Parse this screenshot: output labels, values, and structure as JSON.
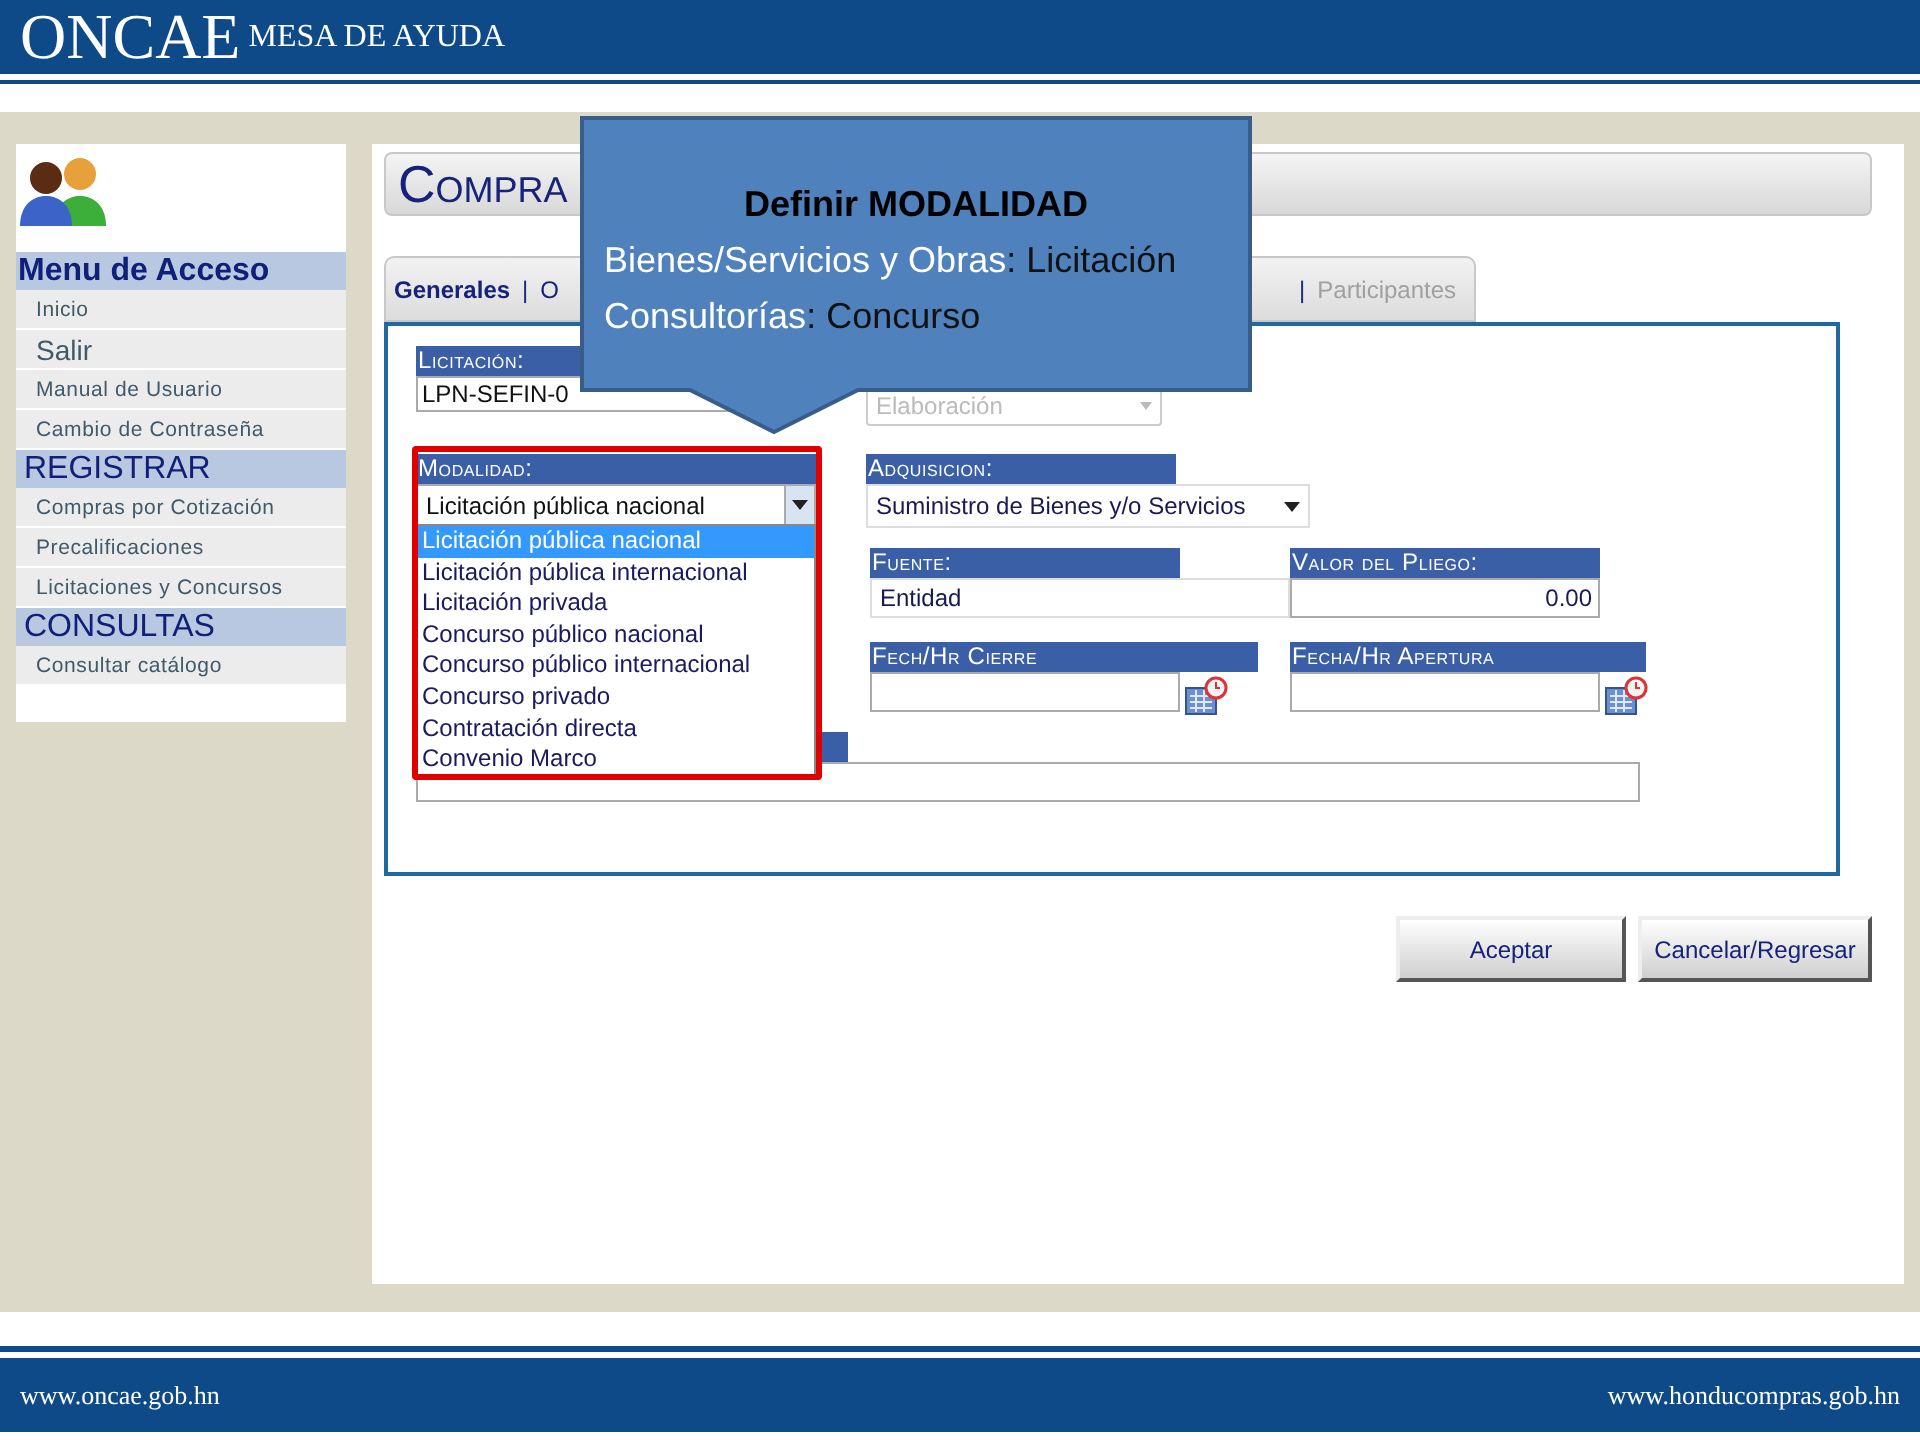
{
  "header": {
    "brand": "ONCAE",
    "subtitle": "MESA DE AYUDA"
  },
  "sidebar": {
    "sections": [
      {
        "title": "Menu de Acceso",
        "kind": "primary",
        "items": [
          {
            "label": "Inicio",
            "kind": "normal"
          },
          {
            "label": "Salir",
            "kind": "large"
          },
          {
            "label": "Manual de Usuario",
            "kind": "normal"
          },
          {
            "label": "Cambio de Contraseña",
            "kind": "normal"
          }
        ]
      },
      {
        "title": "REGISTRAR",
        "kind": "secondary",
        "items": [
          {
            "label": "Compras por Cotización",
            "kind": "normal"
          },
          {
            "label": "Precalificaciones",
            "kind": "normal"
          },
          {
            "label": "Licitaciones y Concursos",
            "kind": "normal"
          }
        ]
      },
      {
        "title": "CONSULTAS",
        "kind": "secondary",
        "items": [
          {
            "label": "Consultar catálogo",
            "kind": "normal"
          }
        ]
      }
    ]
  },
  "page_title": "Compra",
  "tab_separator": "|",
  "tabs": [
    {
      "label": "Generales",
      "selected": true,
      "disabled": false
    },
    {
      "label": "O",
      "selected": false,
      "disabled": false
    },
    {
      "label": "Participantes",
      "selected": false,
      "disabled": true
    }
  ],
  "form": {
    "licitacion": {
      "label": "Licitación:",
      "value": "LPN-SEFIN-0"
    },
    "estado": {
      "value": "Elaboración",
      "disabled": true
    },
    "modalidad": {
      "label": "Modalidad:",
      "value": "Licitación pública nacional",
      "expanded": true,
      "options": [
        {
          "label": "Licitación pública nacional",
          "selected": true
        },
        {
          "label": "Licitación pública internacional",
          "selected": false
        },
        {
          "label": "Licitación privada",
          "selected": false
        },
        {
          "label": "Concurso público nacional",
          "selected": false
        },
        {
          "label": "Concurso público internacional",
          "selected": false
        },
        {
          "label": "Concurso privado",
          "selected": false
        },
        {
          "label": "Contratación directa",
          "selected": false
        },
        {
          "label": "Convenio Marco",
          "selected": false
        }
      ]
    },
    "adquisicion": {
      "label": "Adquisicion:",
      "value": "Suministro de Bienes y/o Servicios"
    },
    "fuente": {
      "label": "Fuente:",
      "value": "Entidad"
    },
    "valor_pliego": {
      "label": "Valor del Pliego:",
      "value": "0.00"
    },
    "fecha_cierre": {
      "label": "Fech/Hr Cierre"
    },
    "fecha_apertura": {
      "label": "Fecha/Hr Apertura"
    }
  },
  "buttons": [
    "Aceptar",
    "Cancelar/Regresar"
  ],
  "callout": {
    "title": "Definir MODALIDAD",
    "lines": [
      {
        "lead": "Bienes/Servicios y Obras",
        "rest": ": Licitación"
      },
      {
        "lead": "Consultorías",
        "rest": ": Concurso"
      }
    ]
  },
  "footer": {
    "left": "www.oncae.gob.hn",
    "right": "www.honducompras.gob.hn"
  }
}
